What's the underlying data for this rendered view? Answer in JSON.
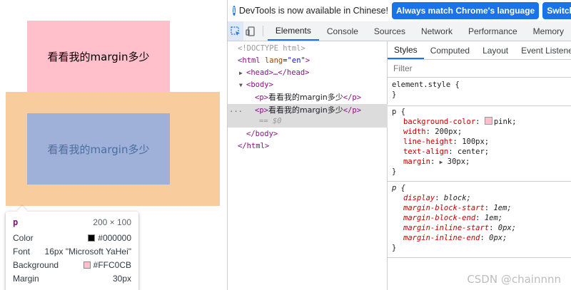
{
  "preview": {
    "paragraph_text": "看看我的margin多少",
    "p1_bg": "#ffc0cb",
    "margin_overlay_color": "#f9cc9d",
    "content_overlay_color": "#9fb0d9"
  },
  "tooltip": {
    "tag": "p",
    "dimensions": "200 × 100",
    "rows": [
      {
        "label": "Color",
        "value": "#000000",
        "swatch": "#000000"
      },
      {
        "label": "Font",
        "value": "16px \"Microsoft YaHei\""
      },
      {
        "label": "Background",
        "value": "#FFC0CB",
        "swatch": "#FFC0CB"
      },
      {
        "label": "Margin",
        "value": "30px"
      }
    ]
  },
  "infobar": {
    "message": "DevTools is now available in Chinese!",
    "match_button": "Always match Chrome's language",
    "switch_button": "Switch DevTools to Chinese"
  },
  "main_tabs": [
    "Elements",
    "Console",
    "Sources",
    "Network",
    "Performance",
    "Memory"
  ],
  "elements_tree": {
    "doctype": "<!DOCTYPE html>",
    "html_open": "<html",
    "lang_attr": "lang",
    "lang_value": "\"en\"",
    "html_open_end": ">",
    "head": "<head>…</head>",
    "body_open": "<body>",
    "p_open": "<p>",
    "p_close": "</p>",
    "p_text": "看看我的margin多少",
    "dollar": "== $0",
    "dots": "...",
    "body_close": "</body>",
    "html_close": "</html>"
  },
  "styles": {
    "subtabs": [
      "Styles",
      "Computed",
      "Layout",
      "Event Listeners"
    ],
    "filter_placeholder": "Filter",
    "element_style": "element.style {",
    "close_brace": "}",
    "rule1_selector": "p {",
    "rule1": [
      {
        "name": "background-color",
        "value": "pink;",
        "swatch": "#ffc0cb"
      },
      {
        "name": "width",
        "value": "200px;"
      },
      {
        "name": "line-height",
        "value": "100px;"
      },
      {
        "name": "text-align",
        "value": "center;"
      },
      {
        "name": "margin",
        "value": "30px;",
        "expander": "▶"
      }
    ],
    "rule2_selector": "p {",
    "rule2": [
      {
        "name": "display",
        "value": "block;"
      },
      {
        "name": "margin-block-start",
        "value": "1em;"
      },
      {
        "name": "margin-block-end",
        "value": "1em;"
      },
      {
        "name": "margin-inline-start",
        "value": "0px;"
      },
      {
        "name": "margin-inline-end",
        "value": "0px;"
      }
    ]
  },
  "watermark": "CSDN @chainnnn"
}
